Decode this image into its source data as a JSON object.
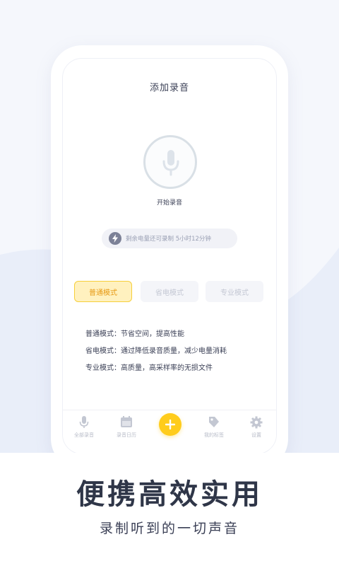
{
  "screen": {
    "title": "添加录音",
    "start_label": "开始录音",
    "battery_info": "剩余电量还可录制  5小时12分钟",
    "modes": [
      {
        "label": "普通模式",
        "active": true
      },
      {
        "label": "省电模式",
        "active": false
      },
      {
        "label": "专业模式",
        "active": false
      }
    ],
    "descriptions": [
      "普通模式：节省空间，提高性能",
      "省电模式：通过降低录音质量，减少电量消耗",
      "专业模式：高质量，高采样率的无损文件"
    ]
  },
  "tabbar": {
    "items": [
      {
        "label": "全部录音",
        "icon": "mic-icon"
      },
      {
        "label": "录音日历",
        "icon": "calendar-icon"
      },
      {
        "label": "",
        "icon": "plus-icon"
      },
      {
        "label": "我的标签",
        "icon": "tag-icon"
      },
      {
        "label": "设置",
        "icon": "gear-icon"
      }
    ]
  },
  "promo": {
    "headline": "便携高效实用",
    "subline": "录制听到的一切声音"
  },
  "colors": {
    "accent": "#ffcc1c",
    "active_mode_text": "#e79a15",
    "active_mode_bg": "#fff1bf",
    "background": "#f4f6fc"
  }
}
